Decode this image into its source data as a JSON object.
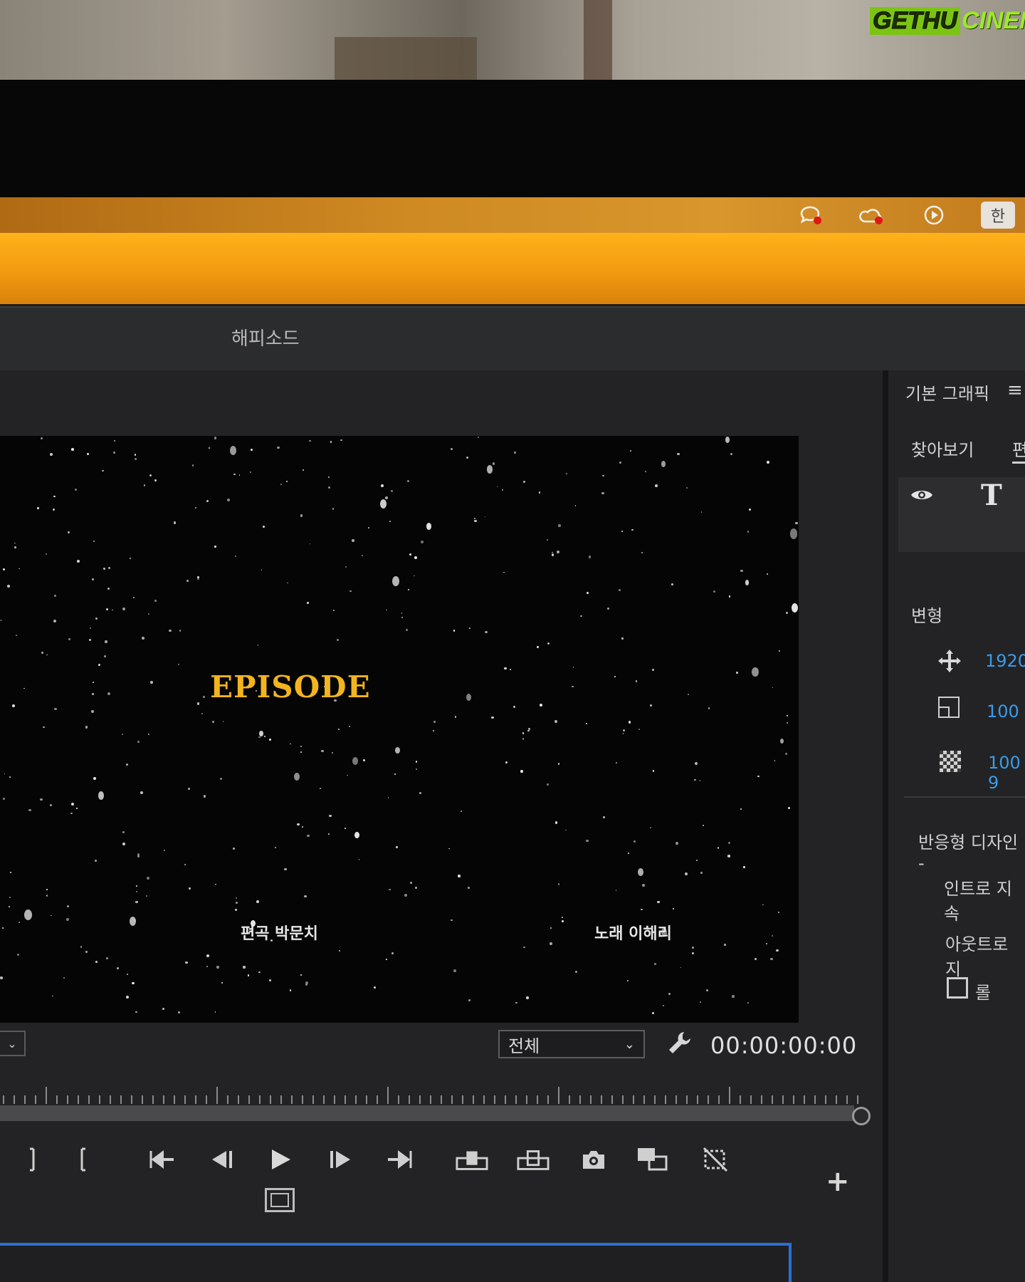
{
  "watermark": {
    "part1": "GETHU",
    "part2": "CINEMA"
  },
  "menubar": {
    "icons": [
      "chat-notification-icon",
      "creative-cloud-icon",
      "play-circle-icon"
    ],
    "input_method": "한"
  },
  "window": {
    "title": "해피소드"
  },
  "preview": {
    "title": "EPISODE",
    "credit_left": "편곡 박문치",
    "credit_right": "노래 이해리"
  },
  "controls": {
    "quality_select": "전체",
    "timecode": "00:00:00:00",
    "add_label": "+"
  },
  "right_panel": {
    "title": "기본 그래픽",
    "tabs": [
      "찾아보기",
      "편"
    ],
    "transform_label": "변형",
    "position_value": "1920",
    "scale_value": "100",
    "opacity_value": "100 9",
    "responsive_label": "반응형 디자인 -",
    "intro_label": "인트로 지속",
    "outro_label": "아웃트로 지",
    "roll_label": "롤"
  },
  "colors": {
    "accent_blue": "#3a9bea",
    "title_gold": "#f2b51e",
    "menubar_orange": "#d8962c"
  }
}
